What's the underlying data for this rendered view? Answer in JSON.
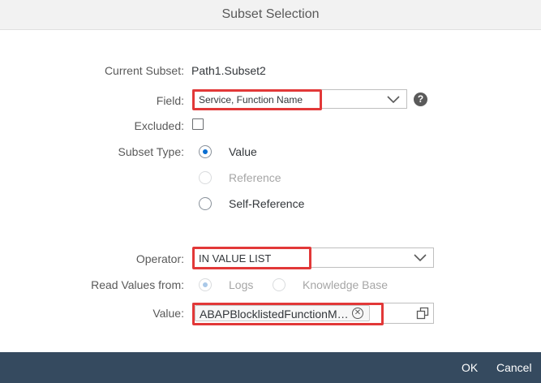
{
  "dialog": {
    "title": "Subset Selection"
  },
  "form": {
    "current_subset": {
      "label": "Current Subset:",
      "value": "Path1.Subset2"
    },
    "field": {
      "label": "Field:",
      "value": "Service, Function Name",
      "help_icon": "question-icon"
    },
    "excluded": {
      "label": "Excluded:",
      "checked": false
    },
    "subset_type": {
      "label": "Subset Type:",
      "options": [
        {
          "label": "Value",
          "selected": true,
          "disabled": false
        },
        {
          "label": "Reference",
          "selected": false,
          "disabled": true
        },
        {
          "label": "Self-Reference",
          "selected": false,
          "disabled": false
        }
      ]
    },
    "operator": {
      "label": "Operator:",
      "value": "IN VALUE LIST"
    },
    "read_values_from": {
      "label": "Read Values from:",
      "options": [
        {
          "label": "Logs",
          "selected": true,
          "disabled": true
        },
        {
          "label": "Knowledge Base",
          "selected": false,
          "disabled": true
        }
      ]
    },
    "value": {
      "label": "Value:",
      "token": "ABAPBlocklistedFunctionM…",
      "expand_icon": "value-help-icon"
    }
  },
  "footer": {
    "ok_label": "OK",
    "cancel_label": "Cancel"
  },
  "colors": {
    "footer_bg": "#354a5f",
    "highlight": "#e23838",
    "accent": "#0a6ed1"
  }
}
